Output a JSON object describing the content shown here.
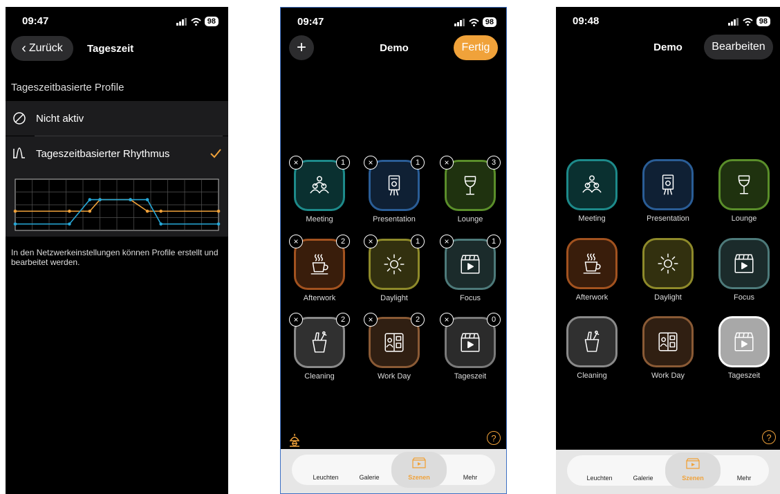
{
  "colors": {
    "accent": "#f0a23a",
    "blue_series": "#26a8d8",
    "orange_series": "#f0a23a"
  },
  "screen1": {
    "status": {
      "time": "09:47",
      "battery": "98"
    },
    "back_label": "Zurück",
    "title": "Tageszeit",
    "section_header": "Tageszeitbasierte Profile",
    "options": [
      {
        "label": "Nicht aktiv",
        "icon": "disabled-circle-icon",
        "selected": false
      },
      {
        "label": "Tageszeitbasierter Rhythmus",
        "icon": "rhythm-curve-icon",
        "selected": true
      }
    ],
    "note": "In den Netzwerkeinstellungen können Profile erstellt und bearbeitet werden.",
    "chart_data": {
      "type": "line",
      "title": "",
      "xlabel": "",
      "ylabel": "",
      "x": [
        0,
        1.6,
        2.2,
        2.5,
        3.4,
        3.9,
        4.3,
        6
      ],
      "ylim": [
        0,
        4
      ],
      "grid": true,
      "series": [
        {
          "color": "#f0a23a",
          "values": [
            1.5,
            1.5,
            1.5,
            2.4,
            2.4,
            1.5,
            1.5,
            1.5
          ]
        },
        {
          "color": "#26a8d8",
          "values": [
            0.5,
            0.5,
            2.4,
            2.4,
            2.4,
            2.4,
            0.5,
            0.5
          ]
        }
      ]
    }
  },
  "screen2": {
    "status": {
      "time": "09:47",
      "battery": "98"
    },
    "add_label": "+",
    "title": "Demo",
    "done_label": "Fertig",
    "remove_label": "×",
    "help_label": "?",
    "scenes": [
      {
        "name": "Meeting",
        "count": "1",
        "color": "#1d8a8a",
        "icon": "people-icon"
      },
      {
        "name": "Presentation",
        "count": "1",
        "color": "#2a5d96",
        "icon": "presentation-icon"
      },
      {
        "name": "Lounge",
        "count": "3",
        "color": "#5a8e2a",
        "icon": "wine-glass-icon"
      },
      {
        "name": "Afterwork",
        "count": "2",
        "color": "#a2521f",
        "icon": "coffee-cup-icon"
      },
      {
        "name": "Daylight",
        "count": "1",
        "color": "#8e8a2a",
        "icon": "sun-icon"
      },
      {
        "name": "Focus",
        "count": "1",
        "color": "#4d7a7a",
        "icon": "clapperboard-icon"
      },
      {
        "name": "Cleaning",
        "count": "2",
        "color": "#8a8a8a",
        "icon": "cleaning-bucket-icon"
      },
      {
        "name": "Work Day",
        "count": "2",
        "color": "#8a5a35",
        "icon": "workday-icon"
      },
      {
        "name": "Tageszeit",
        "count": "0",
        "color": "#7a7a7a",
        "icon": "clapperboard-icon"
      }
    ],
    "tabs": [
      {
        "label": "Leuchten",
        "active": false
      },
      {
        "label": "Galerie",
        "active": false
      },
      {
        "label": "Szenen",
        "active": true
      },
      {
        "label": "Mehr",
        "active": false
      }
    ]
  },
  "screen3": {
    "status": {
      "time": "09:48",
      "battery": "98"
    },
    "title": "Demo",
    "edit_label": "Bearbeiten",
    "help_label": "?",
    "scenes": [
      {
        "name": "Meeting",
        "color": "#1d8a8a",
        "icon": "people-icon"
      },
      {
        "name": "Presentation",
        "color": "#2a5d96",
        "icon": "presentation-icon"
      },
      {
        "name": "Lounge",
        "color": "#5a8e2a",
        "icon": "wine-glass-icon"
      },
      {
        "name": "Afterwork",
        "color": "#a2521f",
        "icon": "coffee-cup-icon"
      },
      {
        "name": "Daylight",
        "color": "#8e8a2a",
        "icon": "sun-icon"
      },
      {
        "name": "Focus",
        "color": "#4d7a7a",
        "icon": "clapperboard-icon"
      },
      {
        "name": "Cleaning",
        "color": "#8a8a8a",
        "icon": "cleaning-bucket-icon"
      },
      {
        "name": "Work Day",
        "color": "#8a5a35",
        "icon": "workday-icon"
      },
      {
        "name": "Tageszeit",
        "color": "#ffffff",
        "icon": "clapperboard-icon",
        "active": true
      }
    ],
    "tabs": [
      {
        "label": "Leuchten",
        "active": false
      },
      {
        "label": "Galerie",
        "active": false
      },
      {
        "label": "Szenen",
        "active": true
      },
      {
        "label": "Mehr",
        "active": false
      }
    ]
  }
}
